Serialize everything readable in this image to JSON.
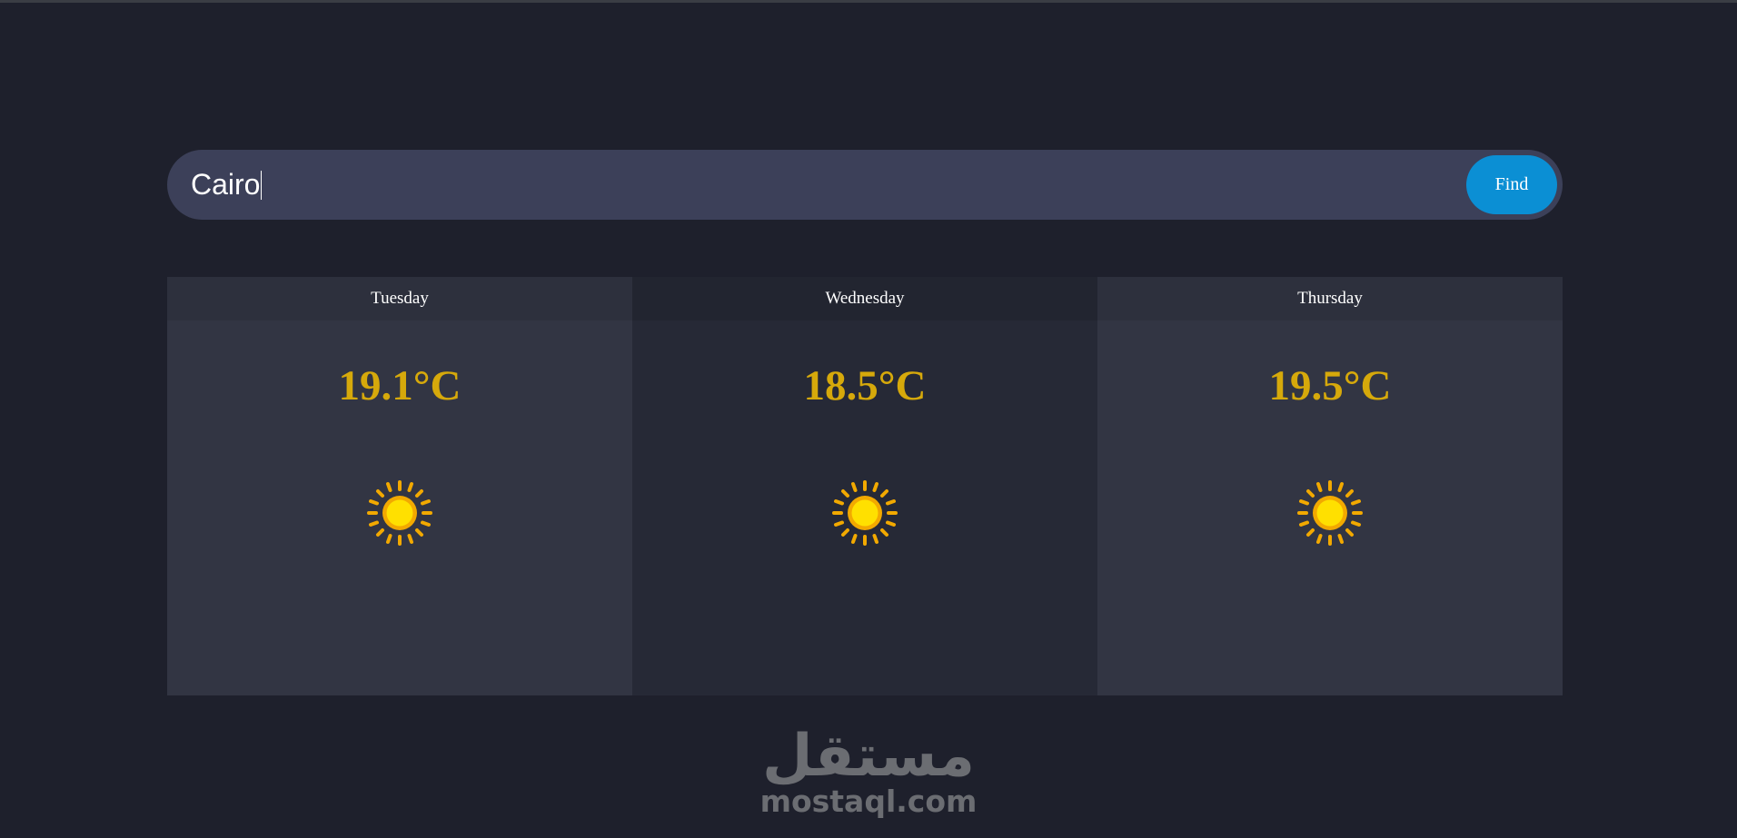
{
  "search": {
    "value": "Cairo",
    "button_label": "Find"
  },
  "forecast": [
    {
      "day": "Tuesday",
      "temp": "19.1°C",
      "icon": "sun-icon"
    },
    {
      "day": "Wednesday",
      "temp": "18.5°C",
      "icon": "sun-icon"
    },
    {
      "day": "Thursday",
      "temp": "19.5°C",
      "icon": "sun-icon"
    }
  ],
  "watermark": {
    "arabic": "مستقل",
    "latin": "mostaql.com"
  },
  "colors": {
    "background": "#1e202c",
    "search_bar": "#3c4059",
    "accent": "#0b8fd4",
    "temperature": "#d6a90b"
  }
}
